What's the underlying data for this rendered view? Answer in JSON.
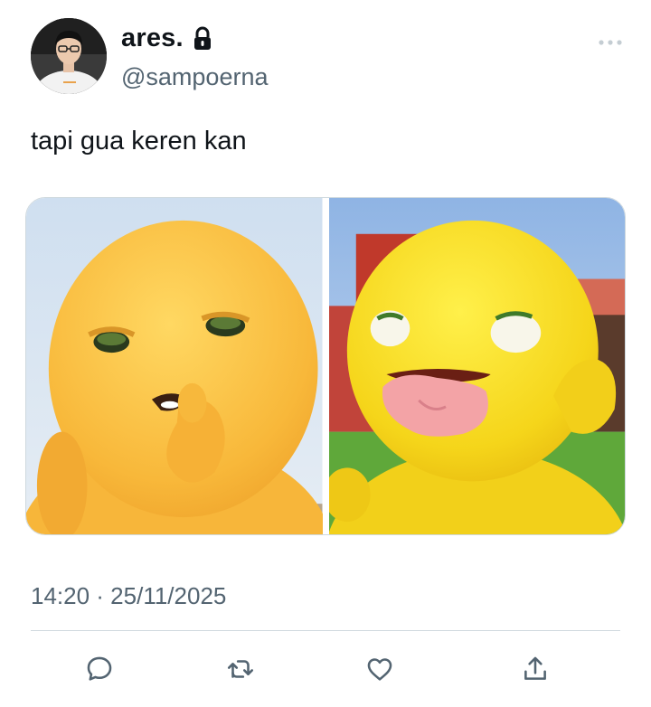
{
  "author": {
    "display_name": "ares.",
    "handle": "@sampoerna",
    "avatar_icon": "avatar-photo",
    "protected_icon": "lock-icon"
  },
  "tweet": {
    "text": "tapi gua keren kan",
    "timestamp": "14:20 · 25/11/2025"
  },
  "media": {
    "count": 2,
    "images": [
      {
        "icon": "yellow-character-finger-mouth"
      },
      {
        "icon": "yellow-character-tongue-out"
      }
    ]
  },
  "actions": {
    "reply_icon": "reply-icon",
    "retweet_icon": "retweet-icon",
    "like_icon": "heart-icon",
    "share_icon": "share-icon"
  },
  "colors": {
    "text_primary": "#0f1419",
    "text_secondary": "#536471",
    "border": "#cfd9de"
  }
}
